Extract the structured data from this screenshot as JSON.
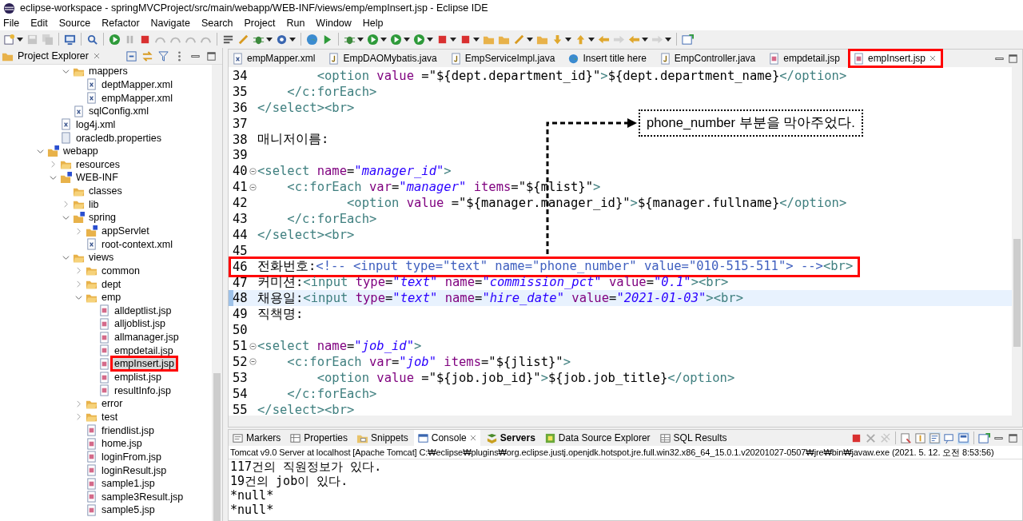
{
  "window": {
    "title": "eclipse-workspace - springMVCProject/src/main/webapp/WEB-INF/views/emp/empInsert.jsp - Eclipse IDE"
  },
  "menu": [
    "File",
    "Edit",
    "Source",
    "Refactor",
    "Navigate",
    "Search",
    "Project",
    "Run",
    "Window",
    "Help"
  ],
  "explorer": {
    "title": "Project Explorer",
    "tree": [
      {
        "children": [
          {
            "children": [
              {
                "label": "mappers",
                "kind": "folder",
                "expanded": true,
                "children": [
                  {
                    "label": "deptMapper.xml",
                    "kind": "xml"
                  },
                  {
                    "label": "empMapper.xml",
                    "kind": "xml"
                  }
                ]
              },
              {
                "label": "sqlConfig.xml",
                "kind": "xml"
              }
            ]
          },
          {
            "label": "log4j.xml",
            "kind": "xml"
          },
          {
            "label": "oracledb.properties",
            "kind": "file"
          }
        ]
      },
      {
        "label": "webapp",
        "kind": "sfolder",
        "expanded": true,
        "children": [
          {
            "label": "resources",
            "kind": "folder",
            "expanded": false
          },
          {
            "label": "WEB-INF",
            "kind": "sfolder",
            "expanded": true,
            "children": [
              {
                "label": "classes",
                "kind": "folder"
              },
              {
                "label": "lib",
                "kind": "folder",
                "expanded": false
              },
              {
                "label": "spring",
                "kind": "sfolder",
                "expanded": true,
                "children": [
                  {
                    "label": "appServlet",
                    "kind": "sfolder",
                    "expanded": false
                  },
                  {
                    "label": "root-context.xml",
                    "kind": "xml"
                  }
                ]
              },
              {
                "label": "views",
                "kind": "folder",
                "expanded": true,
                "children": [
                  {
                    "label": "common",
                    "kind": "folder",
                    "expanded": false
                  },
                  {
                    "label": "dept",
                    "kind": "folder",
                    "expanded": false
                  },
                  {
                    "label": "emp",
                    "kind": "folder",
                    "expanded": true,
                    "children": [
                      {
                        "label": "alldeptlist.jsp",
                        "kind": "jsp",
                        "selected": false,
                        "annotated": false
                      },
                      {
                        "label": "alljoblist.jsp",
                        "kind": "jsp",
                        "selected": false,
                        "annotated": false
                      },
                      {
                        "label": "allmanager.jsp",
                        "kind": "jsp",
                        "selected": false,
                        "annotated": false
                      },
                      {
                        "label": "empdetail.jsp",
                        "kind": "jsp",
                        "selected": false,
                        "annotated": false
                      },
                      {
                        "label": "empInsert.jsp",
                        "kind": "jsp",
                        "selected": true,
                        "annotated": true
                      },
                      {
                        "label": "emplist.jsp",
                        "kind": "jsp",
                        "selected": false,
                        "annotated": false
                      },
                      {
                        "label": "resultInfo.jsp",
                        "kind": "jsp",
                        "selected": false,
                        "annotated": false
                      }
                    ]
                  },
                  {
                    "label": "error",
                    "kind": "folder",
                    "expanded": false
                  },
                  {
                    "label": "test",
                    "kind": "folder",
                    "expanded": false
                  },
                  {
                    "label": "friendlist.jsp",
                    "kind": "jsp"
                  },
                  {
                    "label": "home.jsp",
                    "kind": "jsp"
                  },
                  {
                    "label": "loginFrom.jsp",
                    "kind": "jsp"
                  },
                  {
                    "label": "loginResult.jsp",
                    "kind": "jsp"
                  },
                  {
                    "label": "sample1.jsp",
                    "kind": "jsp"
                  },
                  {
                    "label": "sample3Result.jsp",
                    "kind": "jsp"
                  },
                  {
                    "label": "sample5.jsp",
                    "kind": "jsp"
                  }
                ]
              }
            ]
          }
        ]
      }
    ]
  },
  "editor_tabs": [
    {
      "label": "empMapper.xml",
      "kind": "xml",
      "selected": false,
      "annotated": false
    },
    {
      "label": "EmpDAOMybatis.java",
      "kind": "java",
      "selected": false,
      "annotated": false
    },
    {
      "label": "EmpServiceImpl.java",
      "kind": "java",
      "selected": false,
      "annotated": false
    },
    {
      "label": "Insert title here",
      "kind": "globe",
      "selected": false,
      "annotated": false
    },
    {
      "label": "EmpController.java",
      "kind": "java",
      "selected": false,
      "annotated": false
    },
    {
      "label": "empdetail.jsp",
      "kind": "jsp",
      "selected": false,
      "annotated": false
    },
    {
      "label": "empInsert.jsp",
      "kind": "jsp",
      "selected": true,
      "annotated": true
    }
  ],
  "code": [
    {
      "no": "34",
      "tokens": [
        {
          "kind": "tag",
          "text": "        <option"
        },
        {
          "kind": "attr",
          "text": " value"
        },
        {
          "kind": "plain",
          "text": " =\"${dept.department_id}\""
        },
        {
          "kind": "tag",
          "text": ">"
        },
        {
          "kind": "plain",
          "text": "${dept.department_name}"
        },
        {
          "kind": "tag",
          "text": "</option>"
        }
      ]
    },
    {
      "no": "35",
      "tokens": [
        {
          "kind": "tag",
          "text": "    </c:forEach>"
        }
      ]
    },
    {
      "no": "36",
      "tokens": [
        {
          "kind": "tag",
          "text": "</select><br>"
        }
      ]
    },
    {
      "no": "37"
    },
    {
      "no": "38",
      "tokens": [
        {
          "kind": "plain",
          "text": "매니저이름:"
        }
      ]
    },
    {
      "no": "39"
    },
    {
      "no": "40",
      "fold": true,
      "tokens": [
        {
          "kind": "tag",
          "text": "<select"
        },
        {
          "kind": "attr",
          "text": " name"
        },
        {
          "kind": "plain",
          "text": "="
        },
        {
          "kind": "str",
          "text": "\"manager_id\""
        },
        {
          "kind": "tag",
          "text": ">"
        }
      ]
    },
    {
      "no": "41",
      "fold": true,
      "tokens": [
        {
          "kind": "tag",
          "text": "    <c:forEach"
        },
        {
          "kind": "attr",
          "text": " var"
        },
        {
          "kind": "plain",
          "text": "="
        },
        {
          "kind": "str",
          "text": "\"manager\""
        },
        {
          "kind": "attr",
          "text": " items"
        },
        {
          "kind": "plain",
          "text": "=\"${mlist}\""
        },
        {
          "kind": "tag",
          "text": ">"
        }
      ]
    },
    {
      "no": "42",
      "tokens": [
        {
          "kind": "tag",
          "text": "            <option"
        },
        {
          "kind": "attr",
          "text": " value"
        },
        {
          "kind": "plain",
          "text": " =\"${manager.manager_id}\""
        },
        {
          "kind": "tag",
          "text": ">"
        },
        {
          "kind": "plain",
          "text": "${manager.fullname}"
        },
        {
          "kind": "tag",
          "text": "</option>"
        }
      ]
    },
    {
      "no": "43",
      "tokens": [
        {
          "kind": "tag",
          "text": "    </c:forEach>"
        }
      ]
    },
    {
      "no": "44",
      "tokens": [
        {
          "kind": "tag",
          "text": "</select><br>"
        }
      ]
    },
    {
      "no": "45"
    },
    {
      "no": "46",
      "annotated": true,
      "tokens": [
        {
          "kind": "plain",
          "text": "전화번호:"
        },
        {
          "kind": "comment",
          "text": "<!-- <input type=\"text\" name=\"phone_number\" value=\"010-515-511\"> -->"
        },
        {
          "kind": "tag",
          "text": "<br>"
        }
      ]
    },
    {
      "no": "47",
      "tokens": [
        {
          "kind": "plain",
          "text": "커미션:"
        },
        {
          "kind": "tag",
          "text": "<input"
        },
        {
          "kind": "attr",
          "text": " type"
        },
        {
          "kind": "plain",
          "text": "="
        },
        {
          "kind": "str",
          "text": "\"text\""
        },
        {
          "kind": "attr",
          "text": " name"
        },
        {
          "kind": "plain",
          "text": "="
        },
        {
          "kind": "str",
          "text": "\"commission_pct\""
        },
        {
          "kind": "attr",
          "text": " value"
        },
        {
          "kind": "plain",
          "text": "="
        },
        {
          "kind": "str",
          "text": "\"0.1\""
        },
        {
          "kind": "tag",
          "text": "><br>"
        }
      ]
    },
    {
      "no": "48",
      "current": true,
      "tokens": [
        {
          "kind": "plain",
          "text": "채용일:"
        },
        {
          "kind": "tag",
          "text": "<input"
        },
        {
          "kind": "attr",
          "text": " type"
        },
        {
          "kind": "plain",
          "text": "="
        },
        {
          "kind": "str",
          "text": "\"text\""
        },
        {
          "kind": "attr",
          "text": " name"
        },
        {
          "kind": "plain",
          "text": "="
        },
        {
          "kind": "str",
          "text": "\"hire_date\""
        },
        {
          "kind": "attr",
          "text": " value"
        },
        {
          "kind": "plain",
          "text": "="
        },
        {
          "kind": "str",
          "text": "\"2021-01-03\""
        },
        {
          "kind": "tag",
          "text": "><br>"
        }
      ]
    },
    {
      "no": "49",
      "tokens": [
        {
          "kind": "plain",
          "text": "직책명:"
        }
      ]
    },
    {
      "no": "50"
    },
    {
      "no": "51",
      "fold": true,
      "tokens": [
        {
          "kind": "tag",
          "text": "<select"
        },
        {
          "kind": "attr",
          "text": " name"
        },
        {
          "kind": "plain",
          "text": "="
        },
        {
          "kind": "str",
          "text": "\"job_id\""
        },
        {
          "kind": "tag",
          "text": ">"
        }
      ]
    },
    {
      "no": "52",
      "fold": true,
      "tokens": [
        {
          "kind": "tag",
          "text": "    <c:forEach"
        },
        {
          "kind": "attr",
          "text": " var"
        },
        {
          "kind": "plain",
          "text": "="
        },
        {
          "kind": "str",
          "text": "\"job\""
        },
        {
          "kind": "attr",
          "text": " items"
        },
        {
          "kind": "plain",
          "text": "=\"${jlist}\""
        },
        {
          "kind": "tag",
          "text": ">"
        }
      ]
    },
    {
      "no": "53",
      "tokens": [
        {
          "kind": "tag",
          "text": "        <option"
        },
        {
          "kind": "attr",
          "text": " value"
        },
        {
          "kind": "plain",
          "text": " =\"${job.job_id}\""
        },
        {
          "kind": "tag",
          "text": ">"
        },
        {
          "kind": "plain",
          "text": "${job.job_title}"
        },
        {
          "kind": "tag",
          "text": "</option>"
        }
      ]
    },
    {
      "no": "54",
      "tokens": [
        {
          "kind": "tag",
          "text": "    </c:forEach>"
        }
      ]
    },
    {
      "no": "55",
      "tokens": [
        {
          "kind": "tag",
          "text": "</select><br>"
        }
      ]
    }
  ],
  "callout": {
    "text": "phone_number 부분을 막아주었다."
  },
  "console": {
    "tabs": [
      {
        "label": "Markers",
        "kind": "markers",
        "selected": false,
        "emphasized": false
      },
      {
        "label": "Properties",
        "kind": "properties",
        "selected": false,
        "emphasized": false
      },
      {
        "label": "Snippets",
        "kind": "snippets",
        "selected": false,
        "emphasized": false
      },
      {
        "label": "Console",
        "kind": "console",
        "selected": true,
        "emphasized": false
      },
      {
        "label": "Servers",
        "kind": "servers",
        "selected": false,
        "emphasized": true
      },
      {
        "label": "Data Source Explorer",
        "kind": "datasource",
        "selected": false,
        "emphasized": false
      },
      {
        "label": "SQL Results",
        "kind": "sql",
        "selected": false,
        "emphasized": false
      }
    ],
    "description": "Tomcat v9.0 Server at localhost [Apache Tomcat] C:₩eclipse₩plugins₩org.eclipse.justj.openjdk.hotspot.jre.full.win32.x86_64_15.0.1.v20201027-0507₩jre₩bin₩javaw.exe  (2021. 5. 12. 오전 8:53:56)",
    "output": [
      "117건의 직원정보가 있다.",
      "19건의 job이 있다.",
      "*null*",
      "*null*"
    ]
  }
}
